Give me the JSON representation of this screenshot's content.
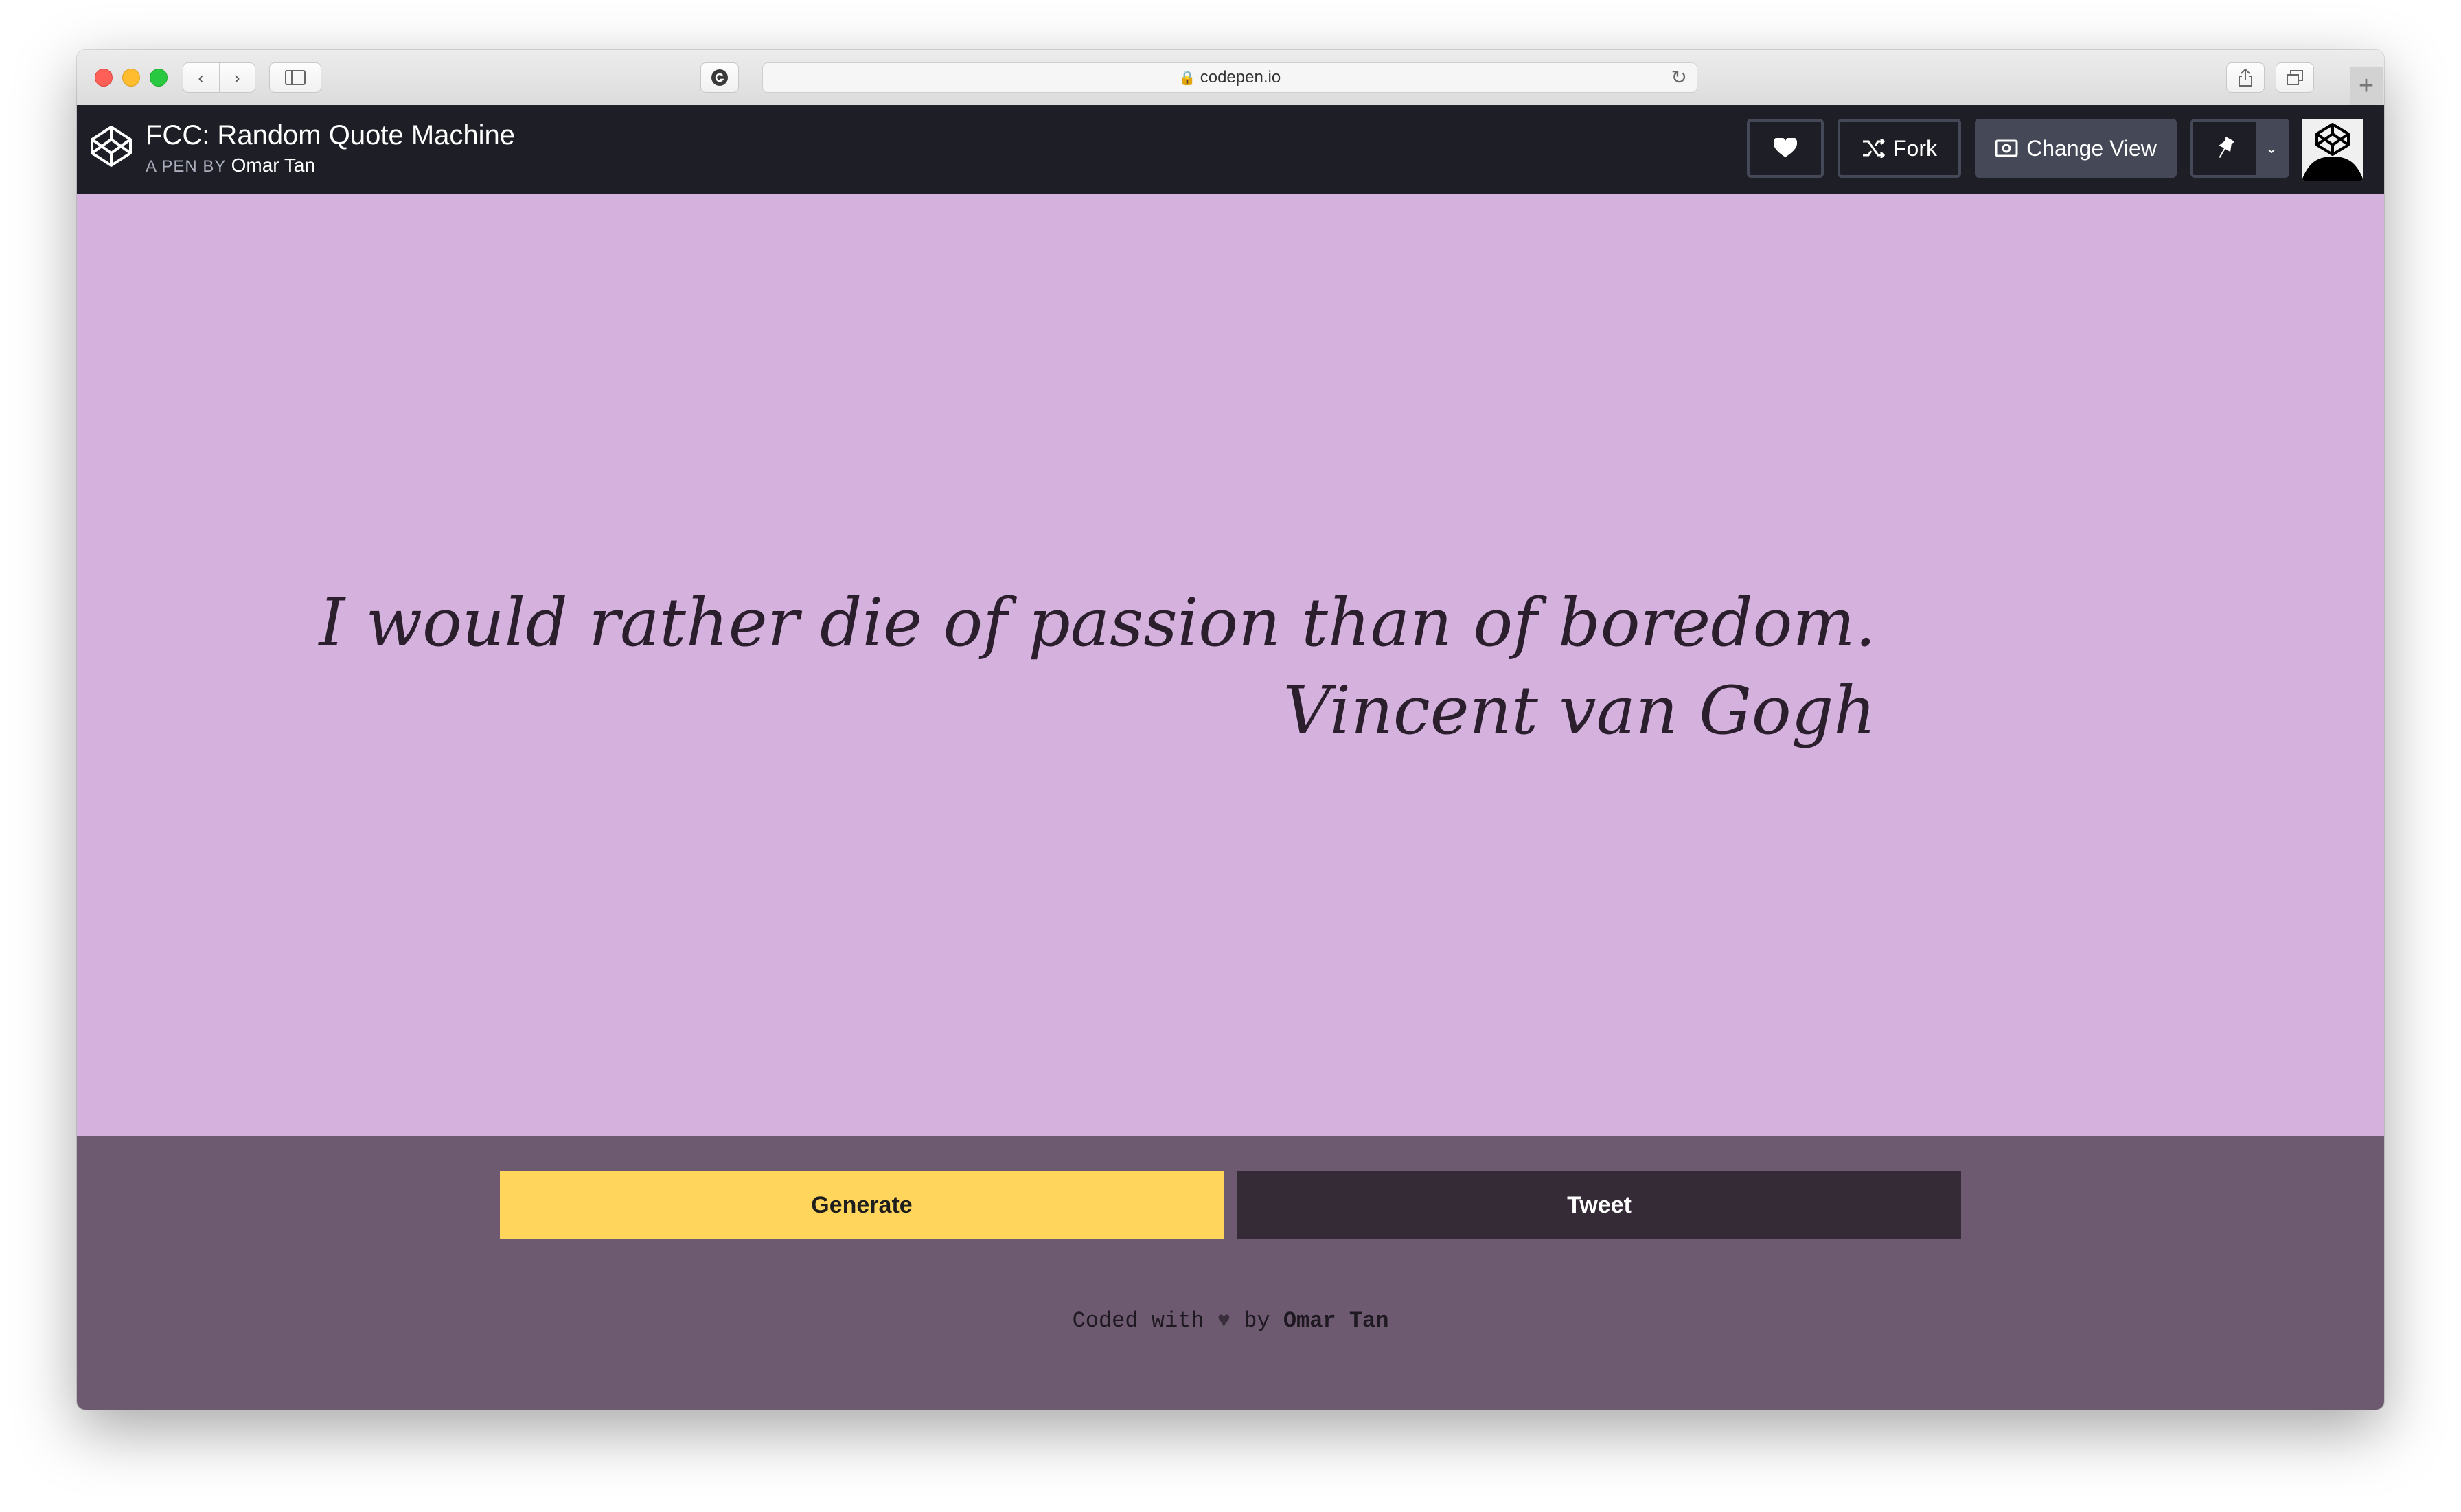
{
  "browser": {
    "url": "codepen.io",
    "new_tab": "+"
  },
  "pen": {
    "title": "FCC: Random Quote Machine",
    "by_label": "A PEN BY",
    "author": "Omar Tan"
  },
  "header_buttons": {
    "fork": "Fork",
    "change_view": "Change View"
  },
  "quote": {
    "text": "I would rather die of passion than of boredom.",
    "author": "Vincent van Gogh"
  },
  "actions": {
    "generate": "Generate",
    "tweet": "Tweet"
  },
  "footer": {
    "prefix": "Coded with ",
    "heart": "♥",
    "middle": " by ",
    "author": "Omar Tan"
  },
  "colors": {
    "quote_background": "#d5b2dd",
    "bottom_background": "#6d5a70",
    "generate_button": "#ffd55c",
    "tweet_button": "#342b36",
    "codepen_header": "#1e1f26"
  }
}
